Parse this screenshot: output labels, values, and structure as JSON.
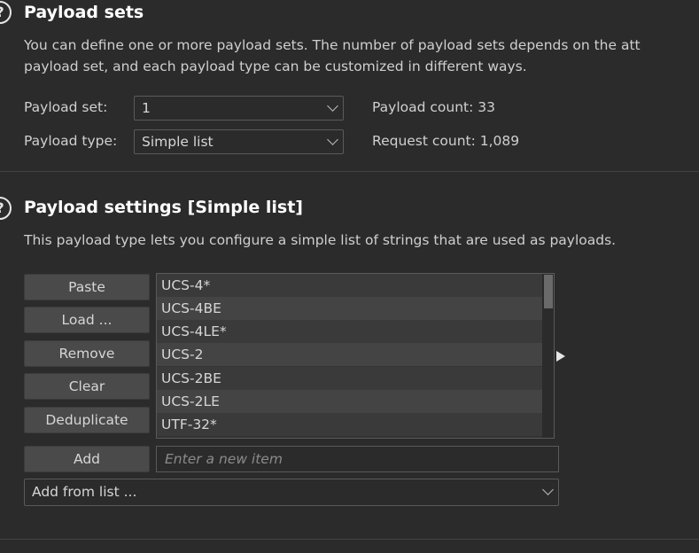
{
  "payload_sets": {
    "title": "Payload sets",
    "description_line1": "You can define one or more payload sets. The number of payload sets depends on the att",
    "description_line2": "payload set, and each payload type can be customized in different ways.",
    "set_label": "Payload set:",
    "set_value": "1",
    "type_label": "Payload type:",
    "type_value": "Simple list",
    "payload_count": "Payload count: 33",
    "request_count": "Request count: 1,089"
  },
  "payload_settings": {
    "title": "Payload settings [Simple list]",
    "description": "This payload type lets you configure a simple list of strings that are used as payloads.",
    "buttons": {
      "paste": "Paste",
      "load": "Load ...",
      "remove": "Remove",
      "clear": "Clear",
      "deduplicate": "Deduplicate",
      "add": "Add"
    },
    "list_items": [
      "UCS-4*",
      "UCS-4BE",
      "UCS-4LE*",
      "UCS-2",
      "UCS-2BE",
      "UCS-2LE",
      "UTF-32*"
    ],
    "new_item_placeholder": "Enter a new item",
    "add_from_list": "Add from list ..."
  },
  "icons": {
    "help": "help-icon",
    "dropdown": "chevron-down-icon",
    "expand": "triangle-right-icon"
  },
  "colors": {
    "background": "#2b2b2b",
    "button": "#4a4a4a",
    "list_row_alt": "#444444"
  }
}
